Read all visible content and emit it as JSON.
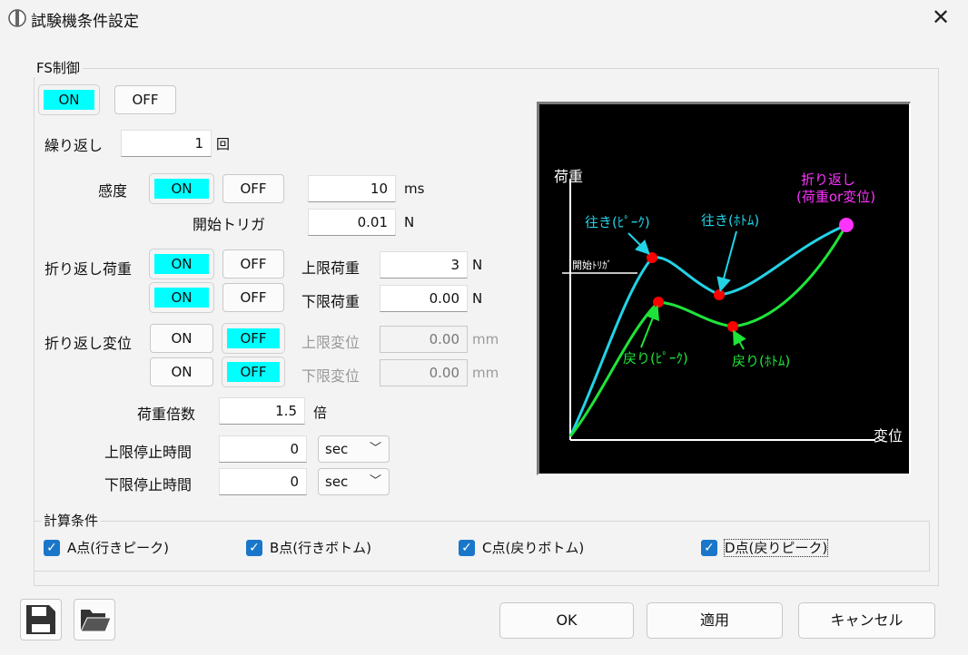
{
  "window": {
    "title": "試験機条件設定",
    "close_symbol": "✕"
  },
  "fs": {
    "group_title": "FS制御",
    "on_label": "ON",
    "off_label": "OFF",
    "repeat_label": "繰り返し",
    "repeat_value": "1",
    "repeat_unit": "回",
    "sensitivity_label": "感度",
    "sens_on": "ON",
    "sens_off": "OFF",
    "sensitivity_value": "10",
    "sensitivity_unit": "ms",
    "trigger_label": "開始トリガ",
    "trigger_value": "0.01",
    "trigger_unit": "N",
    "load_label": "折り返し荷重",
    "load_upper_on": "ON",
    "load_upper_off": "OFF",
    "upper_load_label": "上限荷重",
    "upper_load_value": "3",
    "upper_load_unit": "N",
    "load_lower_on": "ON",
    "load_lower_off": "OFF",
    "lower_load_label": "下限荷重",
    "lower_load_value": "0.00",
    "lower_load_unit": "N",
    "disp_label": "折り返し変位",
    "disp_upper_on": "ON",
    "disp_upper_off": "OFF",
    "upper_disp_label": "上限変位",
    "upper_disp_value": "0.00",
    "upper_disp_unit": "mm",
    "disp_lower_on": "ON",
    "disp_lower_off": "OFF",
    "lower_disp_label": "下限変位",
    "lower_disp_value": "0.00",
    "lower_disp_unit": "mm",
    "load_factor_label": "荷重倍数",
    "load_factor_value": "1.5",
    "load_factor_unit": "倍",
    "upper_stop_label": "上限停止時間",
    "upper_stop_value": "0",
    "upper_stop_unit": "sec",
    "lower_stop_label": "下限停止時間",
    "lower_stop_value": "0",
    "lower_stop_unit": "sec"
  },
  "calc": {
    "group_title": "計算条件",
    "a_label": "A点(行きピーク)",
    "b_label": "B点(行きボトム)",
    "c_label": "C点(戻りボトム)",
    "d_label": "D点(戻りピーク)"
  },
  "graph": {
    "ylabel": "荷重",
    "xlabel": "変位",
    "trigger_label": "開始ﾄﾘｶﾞ",
    "fwd_peak_label": "往き(ﾋﾟｰｸ)",
    "fwd_bottom_label": "往き(ﾎﾄﾑ)",
    "ret_peak_label": "戻り(ﾋﾟｰｸ)",
    "ret_bottom_label": "戻り(ﾎﾄﾑ)",
    "turn_label_1": "折り返し",
    "turn_label_2": "(荷重or変位)",
    "colors": {
      "forward": "#22d3e6",
      "return": "#1ee43a",
      "point": "#ff0000",
      "turn": "#ff33ff"
    }
  },
  "buttons": {
    "ok": "OK",
    "apply": "適用",
    "cancel": "キャンセル"
  },
  "icons": {
    "save": "save-icon",
    "open": "folder-open-icon"
  }
}
